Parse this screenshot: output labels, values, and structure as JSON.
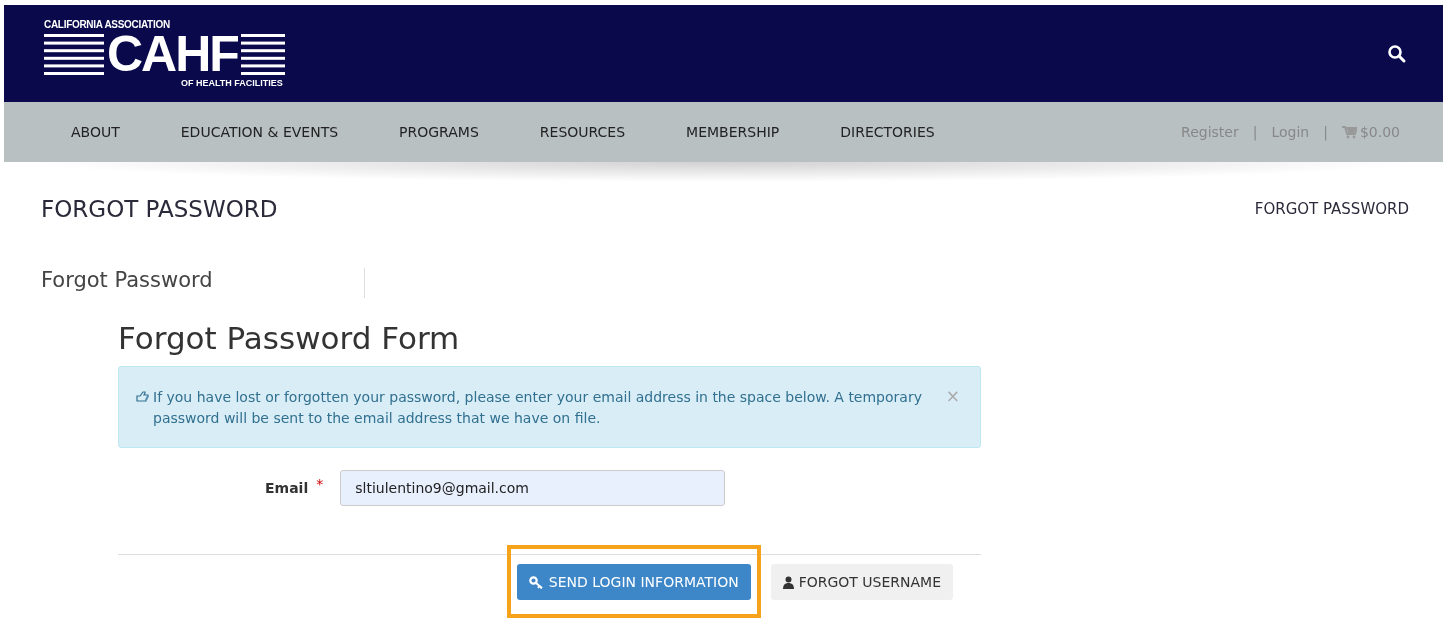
{
  "header": {
    "logo": {
      "top": "CALIFORNIA ASSOCIATION",
      "main": "CAHF",
      "bottom": "OF HEALTH FACILITIES"
    }
  },
  "nav": {
    "items": [
      "ABOUT",
      "EDUCATION & EVENTS",
      "PROGRAMS",
      "RESOURCES",
      "MEMBERSHIP",
      "DIRECTORIES"
    ],
    "account": [
      {
        "label": "Register",
        "kind": "link"
      },
      {
        "label": "|",
        "kind": "separator"
      },
      {
        "label": "Login",
        "kind": "link"
      },
      {
        "label": "|",
        "kind": "separator"
      },
      {
        "label": "$0.00",
        "kind": "cart"
      }
    ]
  },
  "page_title": "FORGOT PASSWORD",
  "breadcrumb": "FORGOT PASSWORD",
  "section_title": "Forgot Password",
  "form": {
    "title": "Forgot Password Form",
    "alert": "If you have lost or forgotten your password, please enter your email address in the space below. A temporary password will be sent to the email address that we have on file.",
    "alert_close": "×",
    "email": {
      "label": "Email",
      "required": true,
      "required_mark": "*",
      "value": "sltiulentino9@gmail.com"
    },
    "buttons": [
      {
        "label": "SEND LOGIN INFORMATION",
        "kind": "primary",
        "highlighted": true
      },
      {
        "label": "FORGOT USERNAME",
        "kind": "secondary",
        "highlighted": false
      }
    ]
  }
}
